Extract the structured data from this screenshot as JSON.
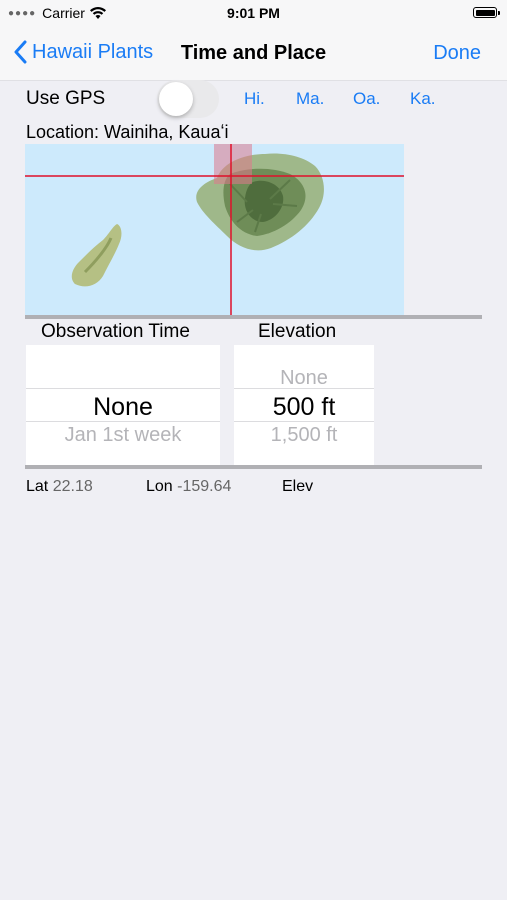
{
  "status_bar": {
    "carrier": "Carrier",
    "time": "9:01 PM"
  },
  "nav": {
    "back_label": "Hawaii Plants",
    "title": "Time and Place",
    "done_label": "Done"
  },
  "gps": {
    "label": "Use GPS",
    "enabled": false,
    "islands": [
      "Hi.",
      "Ma.",
      "Oa.",
      "Ka."
    ]
  },
  "location": {
    "label": "Location: Wainiha, Kauaʻi"
  },
  "columns": {
    "time_header": "Observation Time",
    "elevation_header": "Elevation"
  },
  "time_picker": {
    "above": "",
    "selected": "None",
    "below": "Jan 1st week"
  },
  "elevation_picker": {
    "above": "None",
    "selected": "500 ft",
    "below": "1,500 ft"
  },
  "coords": {
    "lat_label": "Lat",
    "lat_value": "22.18",
    "lon_label": "Lon",
    "lon_value": "-159.64",
    "elev_label": "Elev"
  },
  "colors": {
    "accent": "#1a7cf5",
    "ocean": "#cdeafc",
    "crosshair": "#e0102a"
  }
}
